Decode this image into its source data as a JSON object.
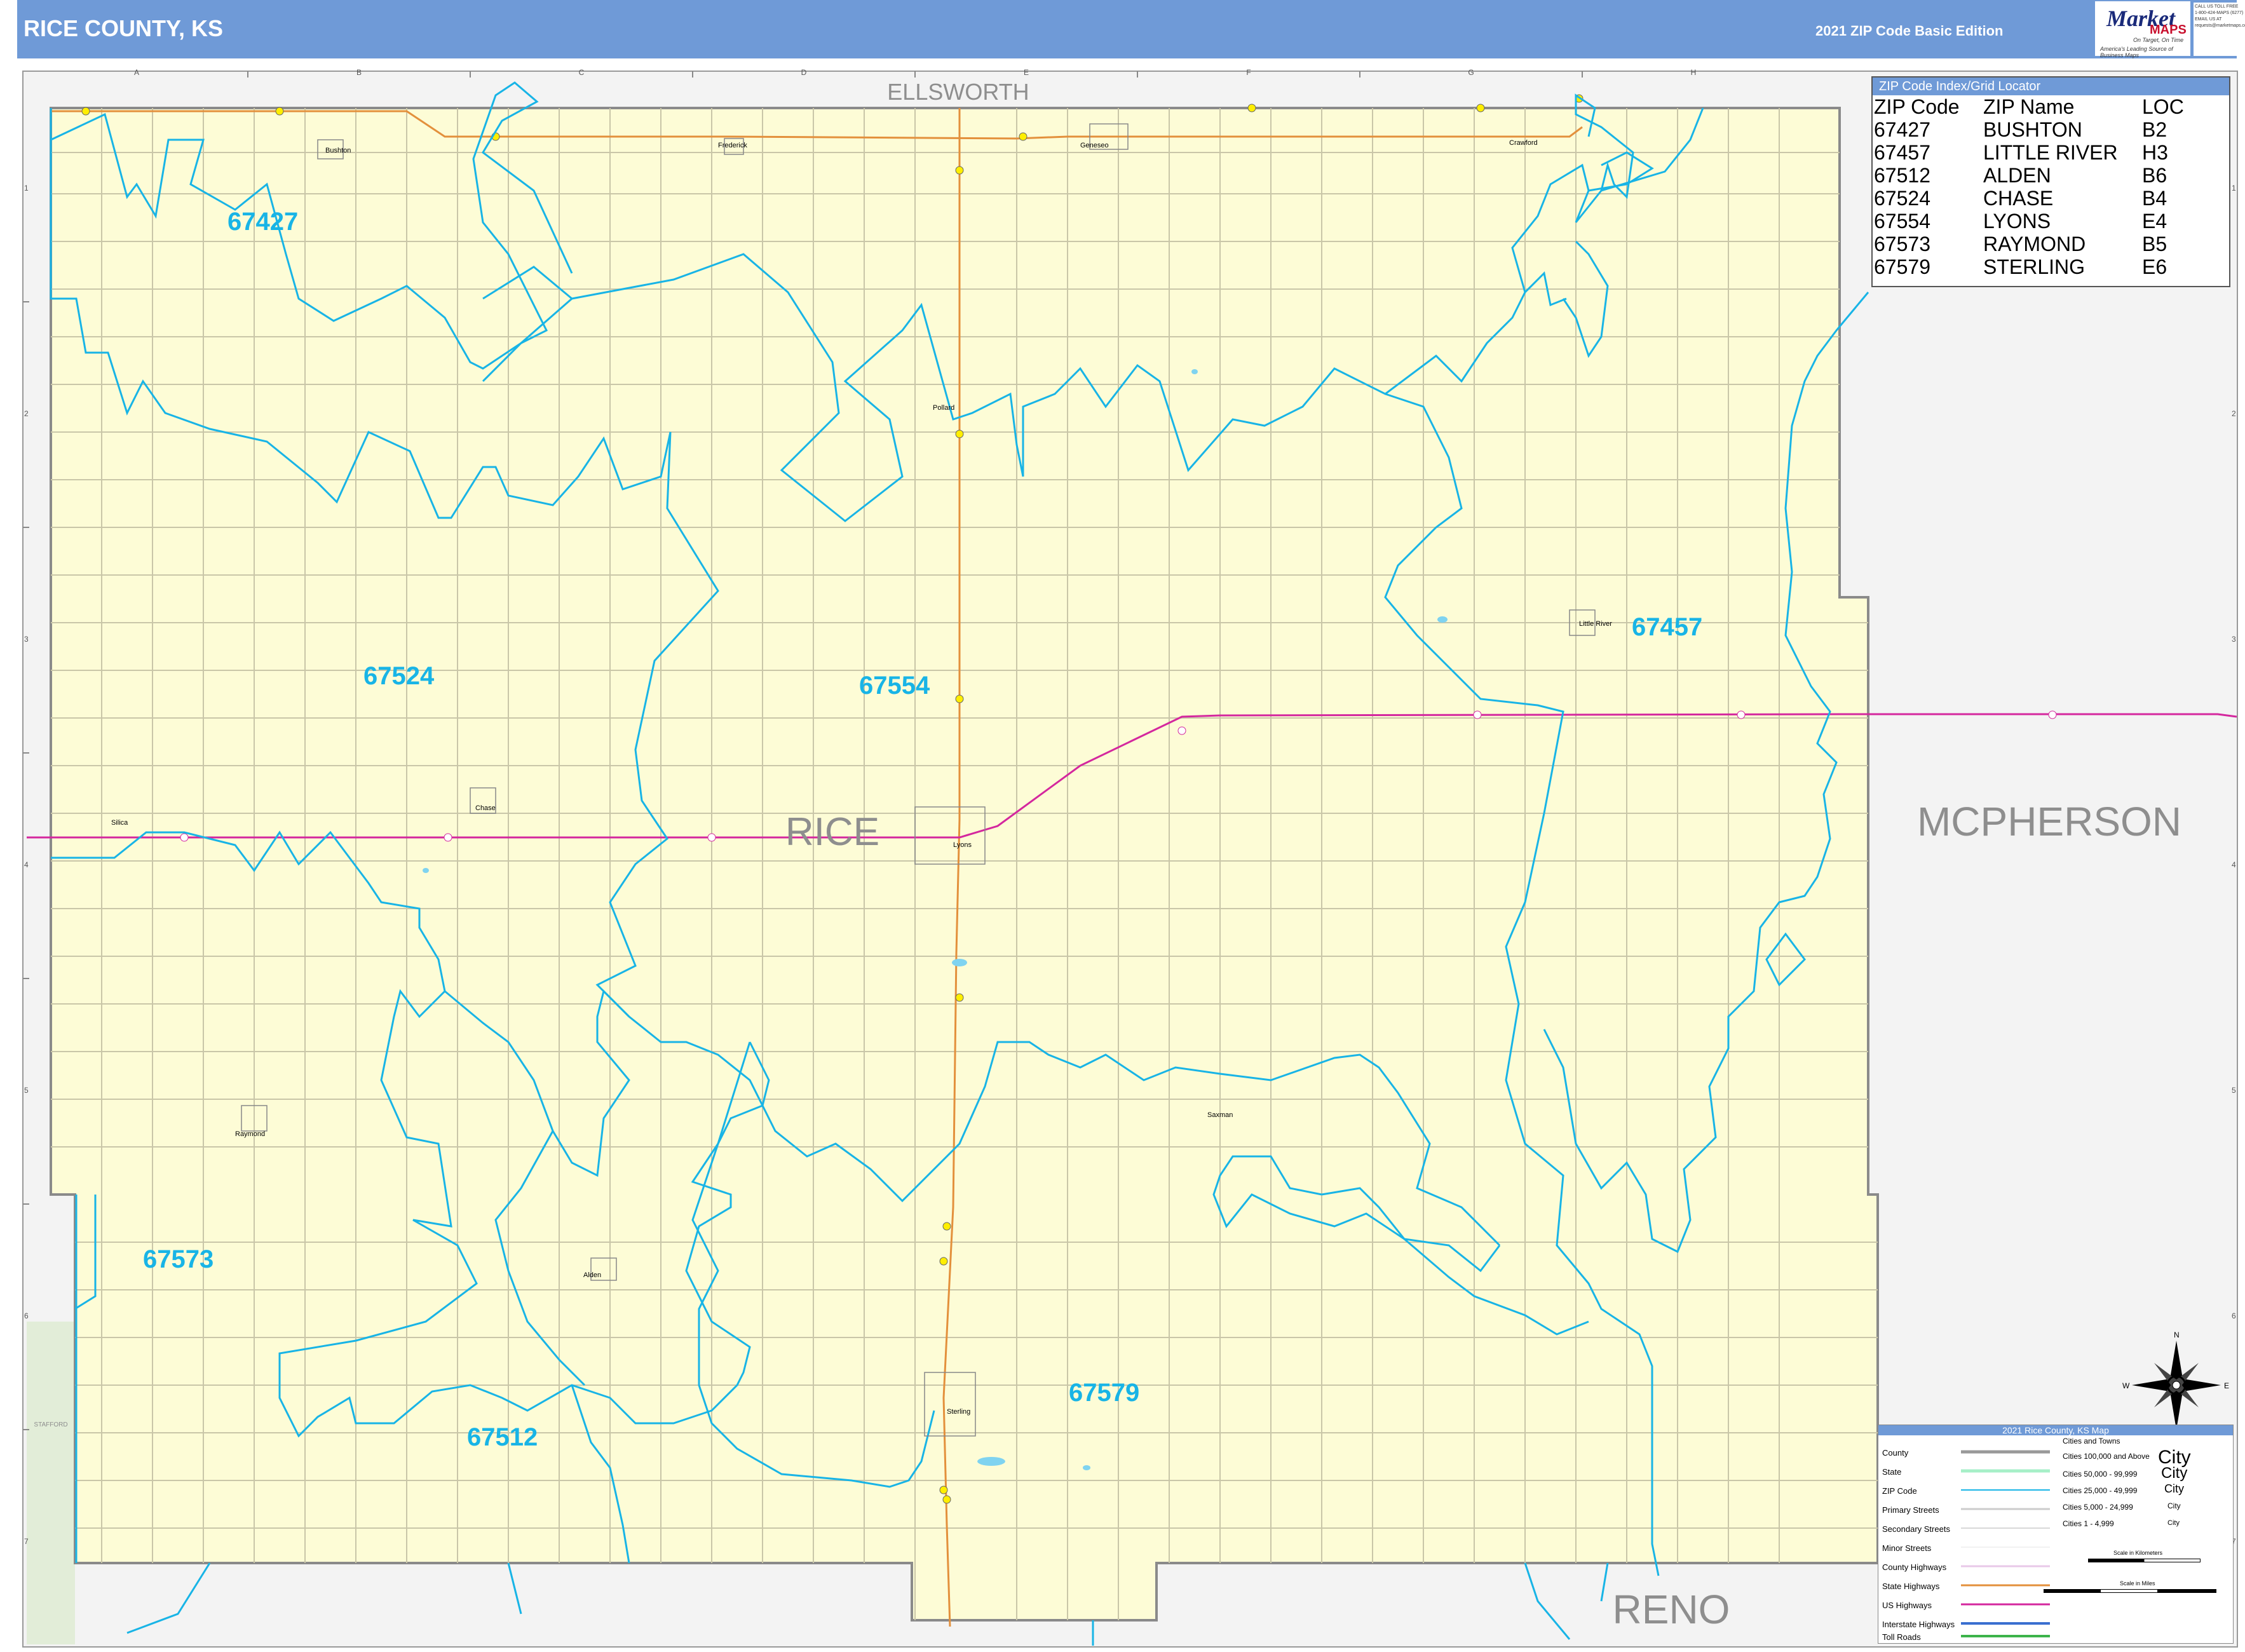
{
  "header": {
    "title": "RICE COUNTY, KS",
    "edition": "2021 ZIP Code Basic Edition",
    "logo_market": "Market",
    "logo_maps": "MAPS",
    "logo_tagline1": "On Target, On Time",
    "logo_tagline2": "America's Leading Source of Business Maps",
    "contact_lines": [
      "CALL US TOLL FREE",
      "1-800-424-MAPS (6277)",
      "EMAIL US AT",
      "requests@marketmaps.com"
    ]
  },
  "map": {
    "county_label": "RICE",
    "neighbors": {
      "north": "ELLSWORTH",
      "east": "MCPHERSON",
      "south": "RENO",
      "west": "STAFFORD"
    },
    "zip_labels": [
      "67427",
      "67524",
      "67554",
      "67457",
      "67573",
      "67512",
      "67579"
    ],
    "places": [
      "Bushton",
      "Frederick",
      "Geneseo",
      "Crawford",
      "Pollard",
      "Little River",
      "Chase",
      "Lyons",
      "Silica",
      "Raymond",
      "Saxman",
      "Alden",
      "Sterling"
    ],
    "grid_columns": [
      "A",
      "B",
      "C",
      "D",
      "E",
      "F",
      "G",
      "H"
    ],
    "grid_rows": [
      "1",
      "2",
      "3",
      "4",
      "5",
      "6",
      "7"
    ],
    "colors": {
      "land": "#fdfcd6",
      "zip_boundary": "#18b4e6",
      "us_highway": "#d4279e",
      "state_highway": "#e3903c",
      "outside": "#f3f3f3",
      "header": "#6f9ad7"
    }
  },
  "index": {
    "title": "ZIP Code Index/Grid Locator",
    "headers": {
      "zip": "ZIP Code",
      "name": "ZIP Name",
      "loc": "LOC"
    },
    "rows": [
      {
        "zip": "67427",
        "name": "BUSHTON",
        "loc": "B2"
      },
      {
        "zip": "67457",
        "name": "LITTLE RIVER",
        "loc": "H3"
      },
      {
        "zip": "67512",
        "name": "ALDEN",
        "loc": "B6"
      },
      {
        "zip": "67524",
        "name": "CHASE",
        "loc": "B4"
      },
      {
        "zip": "67554",
        "name": "LYONS",
        "loc": "E4"
      },
      {
        "zip": "67573",
        "name": "RAYMOND",
        "loc": "B5"
      },
      {
        "zip": "67579",
        "name": "STERLING",
        "loc": "E6"
      }
    ]
  },
  "compass": {
    "n": "N",
    "s": "S",
    "e": "E",
    "w": "W"
  },
  "legend": {
    "title": "2021 Rice County, KS Map",
    "left_items": [
      "County",
      "State",
      "ZIP Code",
      "Primary Streets",
      "Secondary Streets",
      "Minor Streets",
      "County Highways",
      "State Highways",
      "US Highways",
      "Interstate Highways",
      "Toll Roads"
    ],
    "right_title": "Cities and Towns",
    "city_sizes": [
      "Cities 100,000 and Above",
      "Cities 50,000 - 99,999",
      "Cities 25,000 - 49,999",
      "Cities 5,000 - 24,999",
      "Cities 1 - 4,999"
    ],
    "city_sample": "City",
    "scale_km": "Scale in Kilometers",
    "scale_miles": "Scale in Miles"
  }
}
